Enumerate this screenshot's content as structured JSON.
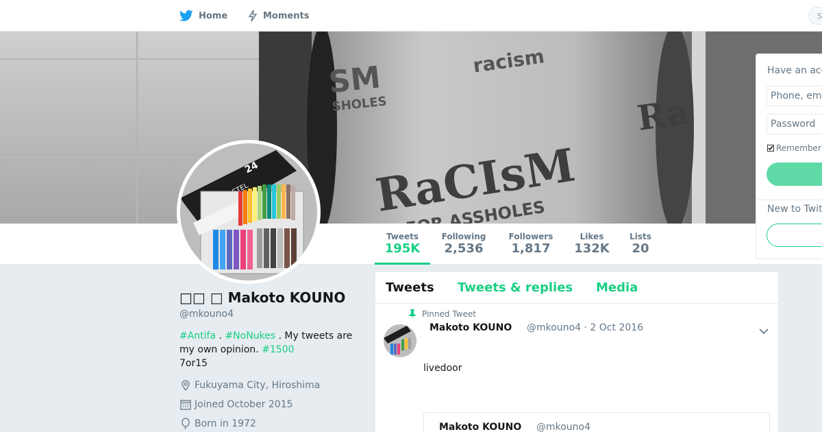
{
  "nav": {
    "home_label": "Home",
    "moments_label": "Moments",
    "search_placeholder": "S"
  },
  "profile": {
    "display_name": "□□ □ Makoto KOUNO",
    "handle": "@mkouno4",
    "bio": {
      "tag1": "#Antifa",
      "sep1": " . ",
      "tag2": "#NoNukes",
      "text": " . My tweets are my own opinion. ",
      "tag3": "#1500",
      "line2": "7or15"
    },
    "location": "Fukuyama City, Hiroshima",
    "joined": "Joined October 2015",
    "born": "Born in 1972"
  },
  "stats": [
    {
      "label": "Tweets",
      "value": "195K"
    },
    {
      "label": "Following",
      "value": "2,536"
    },
    {
      "label": "Followers",
      "value": "1,817"
    },
    {
      "label": "Likes",
      "value": "132K"
    },
    {
      "label": "Lists",
      "value": "20"
    }
  ],
  "timeline": {
    "tabs": [
      "Tweets",
      "Tweets & replies",
      "Media"
    ],
    "pinned_label": "Pinned Tweet",
    "tweet": {
      "name": "Makoto KOUNO",
      "handle_date": "@mkouno4 · 2 Oct 2016",
      "text": "livedoor",
      "quote_name": "Makoto KOUNO",
      "quote_handle": "@mkouno4"
    }
  },
  "login": {
    "title": "Have an account?",
    "phone_placeholder": "Phone, email or username",
    "password_placeholder": "Password",
    "remember_label": "Remember me",
    "new_label": "New to Twitter?"
  },
  "banner": {
    "text_main": "RaCIsM",
    "text_sub": "IS FOR ASSHOLES",
    "text_top": "SM",
    "text_top2": "SHOLES"
  },
  "avatar": {
    "box_number": "24",
    "box_text": "CARRE PASTEL"
  },
  "colors": {
    "accent": "#19cf86",
    "twitter_blue": "#1da1f2"
  }
}
